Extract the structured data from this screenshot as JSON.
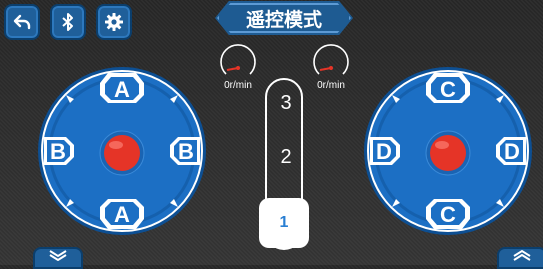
{
  "header": {
    "title": "遥控模式"
  },
  "toolbar": {
    "back_icon": "back-arrow-icon",
    "bluetooth_icon": "bluetooth-icon",
    "settings_icon": "gear-icon"
  },
  "speed": {
    "left": {
      "label": "0r/min",
      "value": 0
    },
    "right": {
      "label": "0r/min",
      "value": 0
    }
  },
  "gear_slider": {
    "levels": [
      "3",
      "2"
    ],
    "selected": "1"
  },
  "left_joystick": {
    "up_label": "A",
    "down_label": "A",
    "left_label": "B",
    "right_label": "B"
  },
  "right_joystick": {
    "up_label": "C",
    "down_label": "C",
    "left_label": "D",
    "right_label": "D"
  },
  "colors": {
    "accent": "#1e5b92",
    "joystick": "#1c6fc4",
    "knob": "#e53427"
  }
}
